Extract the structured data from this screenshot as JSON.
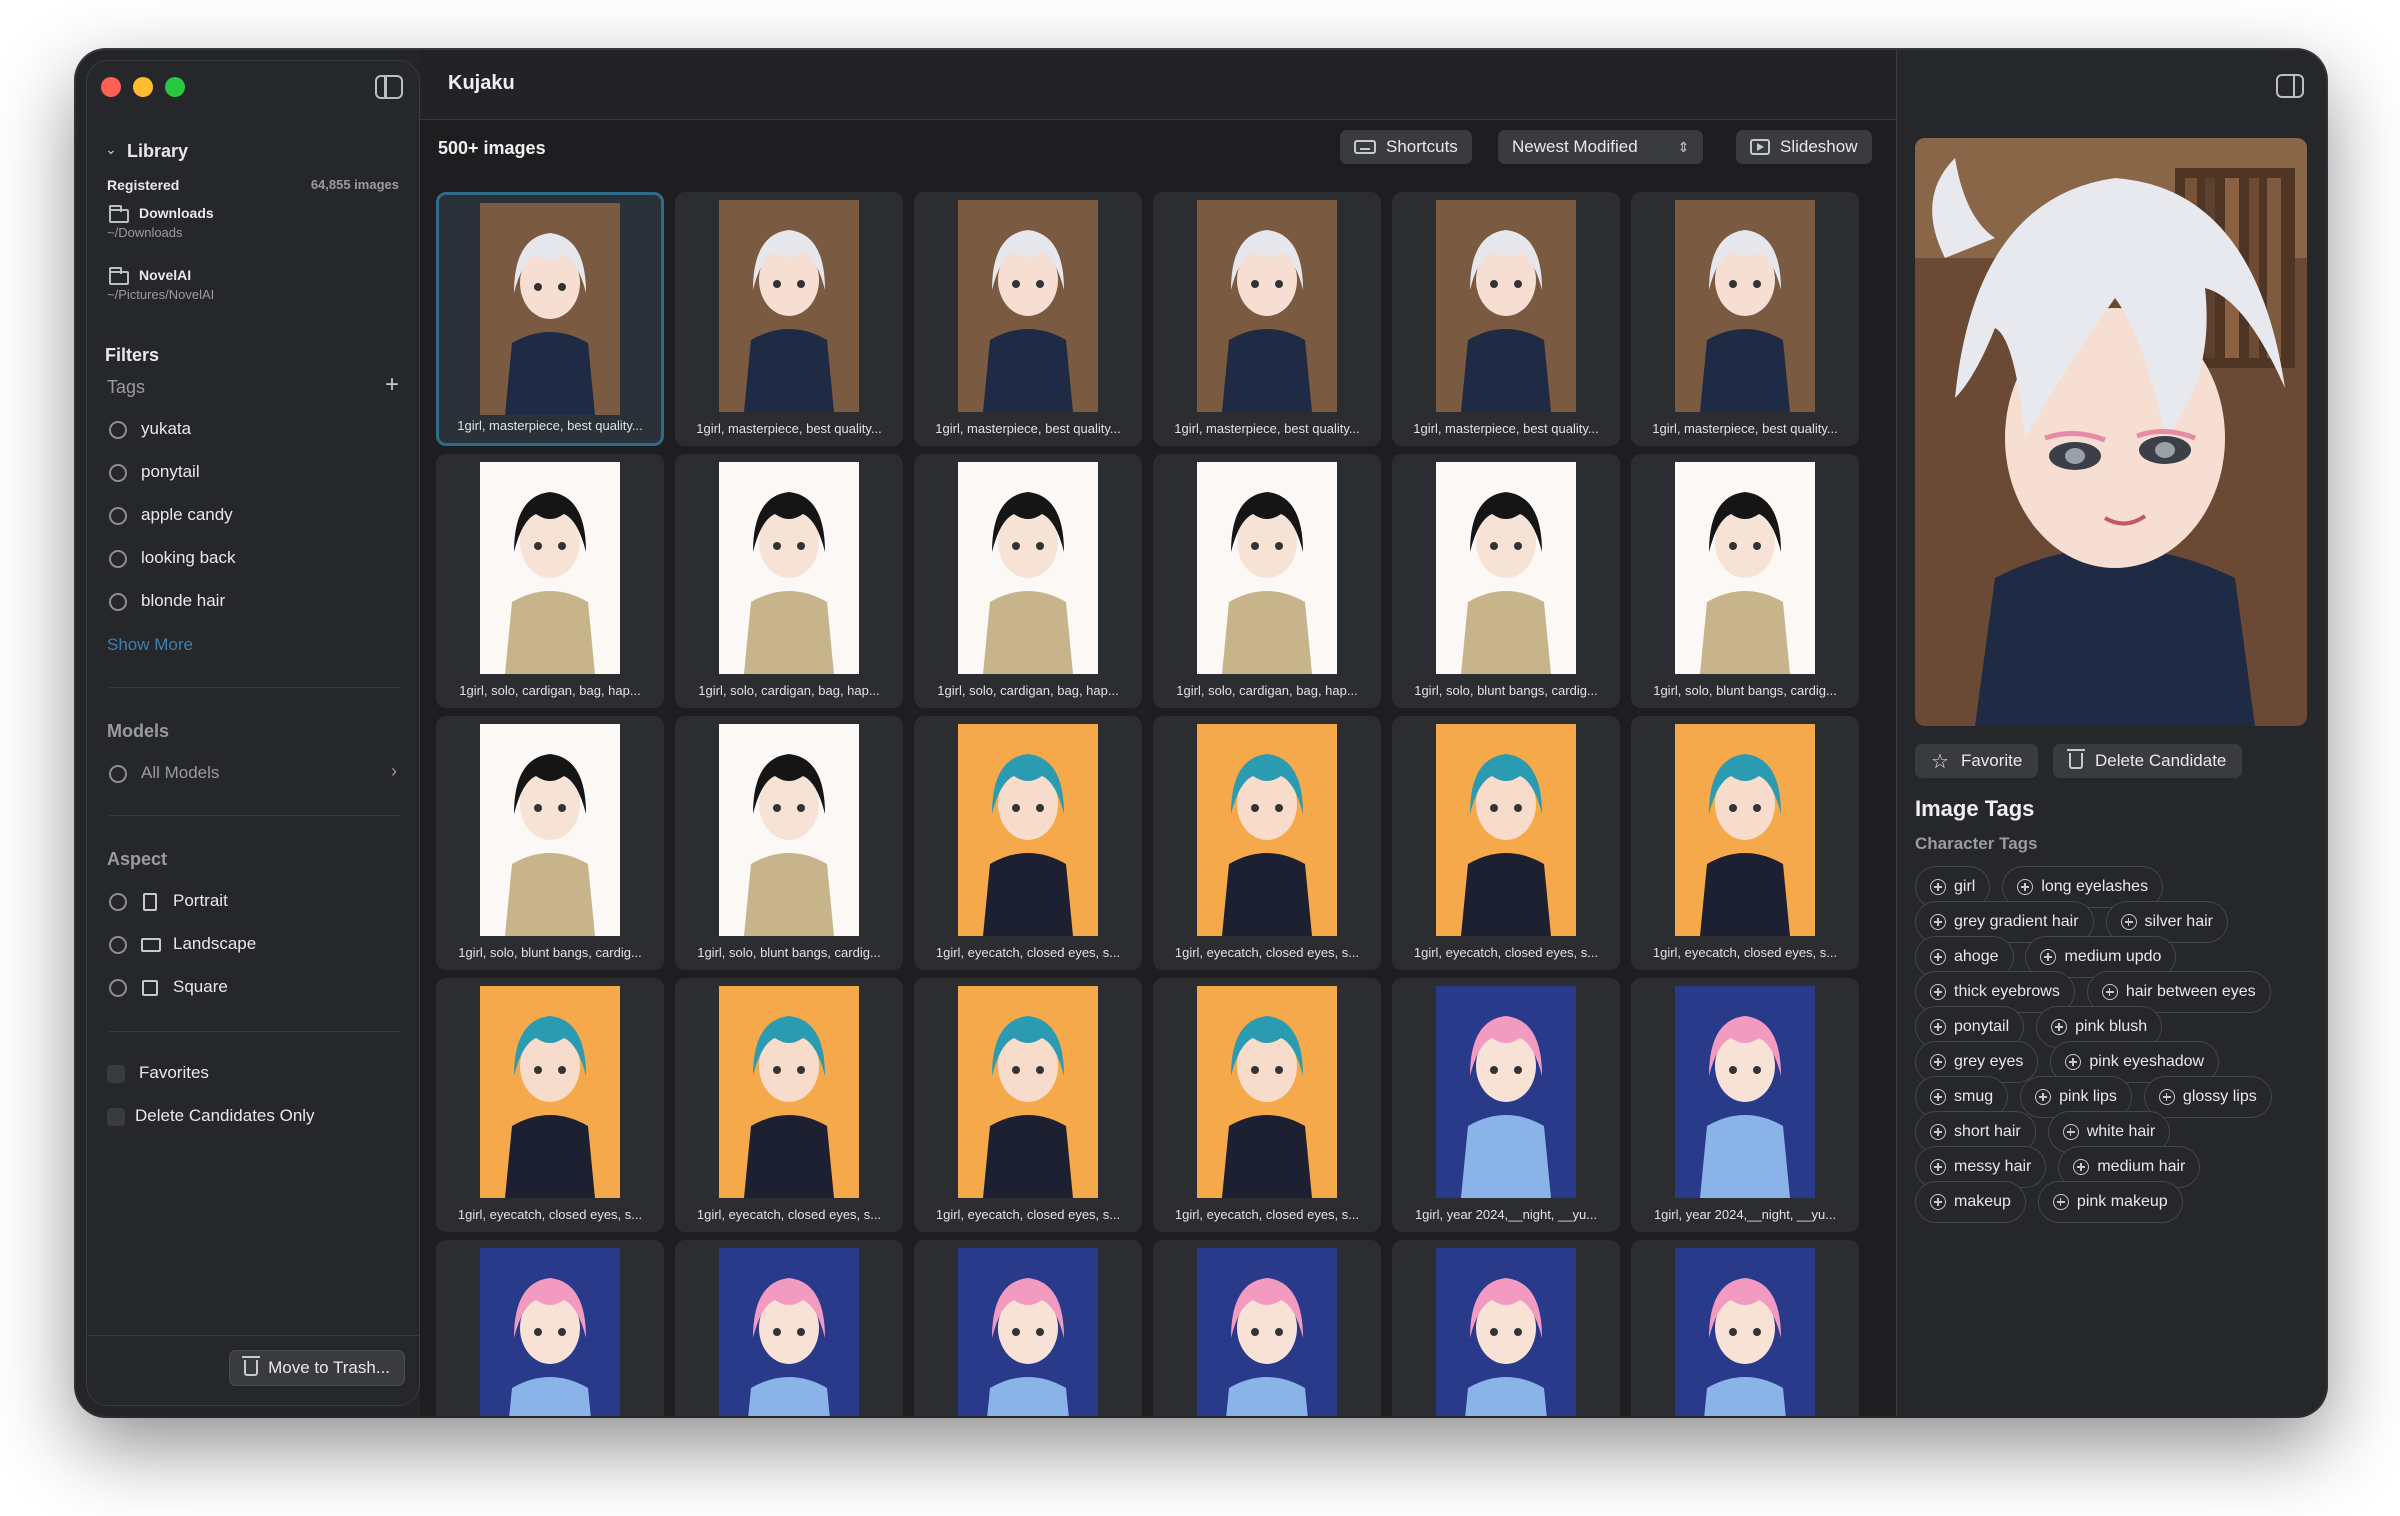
{
  "app": {
    "title": "Kujaku"
  },
  "sidebar": {
    "library_label": "Library",
    "registered_label": "Registered",
    "registered_count": "64,855 images",
    "folders": [
      {
        "name": "Downloads",
        "path": "~/Downloads"
      },
      {
        "name": "NovelAI",
        "path": "~/Pictures/NovelAI"
      }
    ],
    "filters_label": "Filters",
    "tags_label": "Tags",
    "tags": [
      "yukata",
      "ponytail",
      "apple candy",
      "looking back",
      "blonde hair"
    ],
    "show_more": "Show More",
    "models_label": "Models",
    "all_models": "All Models",
    "aspect_label": "Aspect",
    "aspects": [
      "Portrait",
      "Landscape",
      "Square"
    ],
    "favorites": "Favorites",
    "delete_candidates_only": "Delete Candidates Only",
    "move_to_trash": "Move to Trash..."
  },
  "toolbar": {
    "image_count": "500+ images",
    "shortcuts": "Shortcuts",
    "sort": "Newest Modified",
    "slideshow": "Slideshow"
  },
  "grid": {
    "captions": [
      "1girl, masterpiece, best quality...",
      "1girl, masterpiece, best quality...",
      "1girl, masterpiece, best quality...",
      "1girl, masterpiece, best quality...",
      "1girl, masterpiece, best quality...",
      "1girl, masterpiece, best quality...",
      "1girl,  solo, cardigan, bag, hap...",
      "1girl,  solo, cardigan, bag, hap...",
      "1girl,  solo, cardigan, bag, hap...",
      "1girl,  solo, cardigan, bag, hap...",
      "1girl,  solo, blunt bangs, cardig...",
      "1girl,  solo, blunt bangs, cardig...",
      "1girl,  solo, blunt bangs, cardig...",
      "1girl,  solo, blunt bangs, cardig...",
      "1girl, eyecatch,  closed eyes, s...",
      "1girl, eyecatch,  closed eyes, s...",
      "1girl, eyecatch,  closed eyes, s...",
      "1girl, eyecatch,  closed eyes, s...",
      "1girl, eyecatch,  closed eyes, s...",
      "1girl, eyecatch,  closed eyes, s...",
      "1girl, eyecatch,  closed eyes, s...",
      "1girl, eyecatch,  closed eyes, s...",
      "1girl,  year 2024,__night, __yu...",
      "1girl,  year 2024,__night, __yu...",
      "",
      "",
      "",
      "",
      "",
      ""
    ]
  },
  "inspector": {
    "favorite": "Favorite",
    "delete_candidate": "Delete Candidate",
    "image_tags_title": "Image Tags",
    "character_tags_label": "Character Tags",
    "tags": [
      "girl",
      "long eyelashes",
      "grey gradient hair",
      "silver hair",
      "ahoge",
      "medium updo",
      "thick eyebrows",
      "hair between eyes",
      "ponytail",
      "pink blush",
      "grey eyes",
      "pink eyeshadow",
      "smug",
      "pink lips",
      "glossy lips",
      "short hair",
      "white hair",
      "messy hair",
      "medium hair",
      "makeup",
      "pink makeup"
    ]
  },
  "colors": {
    "accent_blue": "#4a90c8",
    "selection_border": "#2e6c8a",
    "background": "#242528"
  }
}
